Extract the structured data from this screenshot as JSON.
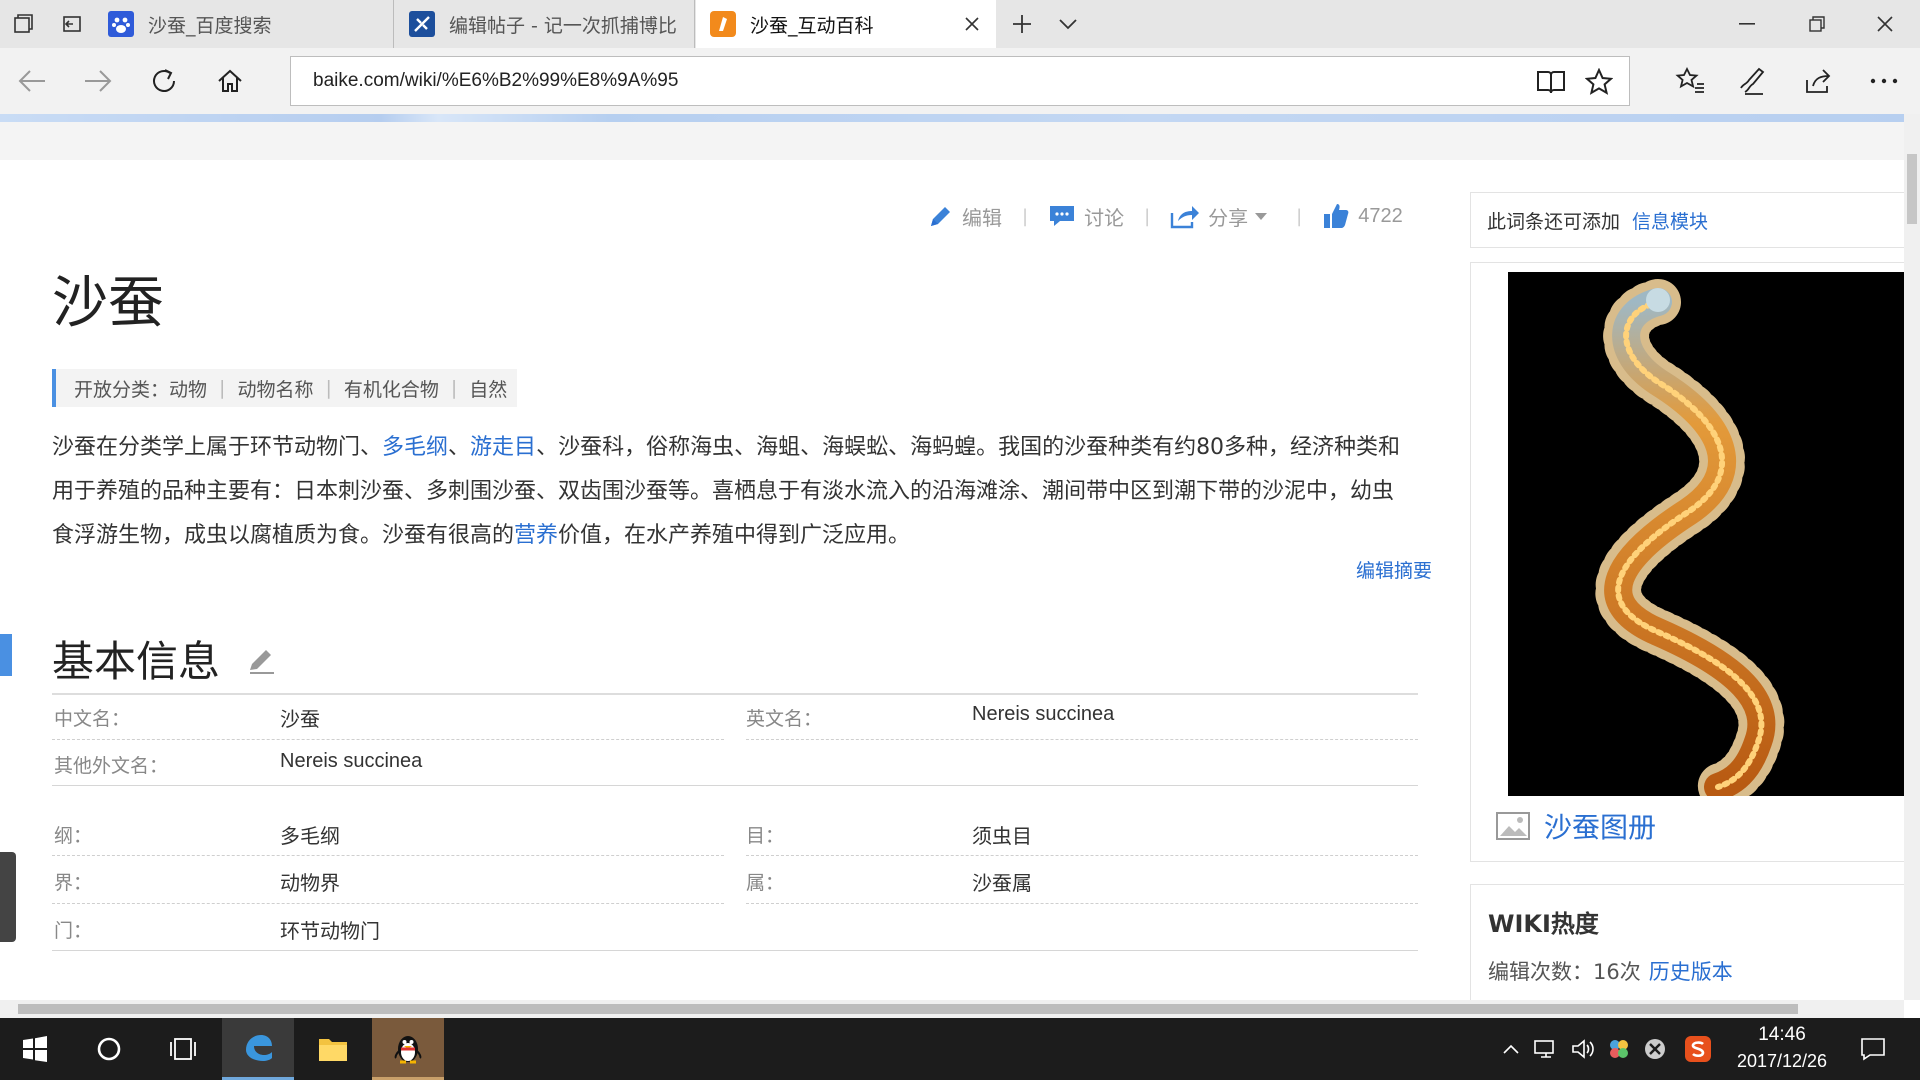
{
  "tabs": [
    {
      "label": "沙蚕_百度搜索",
      "state": "inactive",
      "favicon": "baidu-paw-icon"
    },
    {
      "label": "编辑帖子 - 记一次抓捕博比",
      "state": "inactive",
      "favicon": "csdn-edit-icon"
    },
    {
      "label": "沙蚕_互动百科",
      "state": "active",
      "favicon": "hudong-baike-icon"
    }
  ],
  "address": {
    "url": "baike.com/wiki/%E6%B2%99%E8%9A%95"
  },
  "article": {
    "actions": {
      "edit": "编辑",
      "discuss": "讨论",
      "share": "分享",
      "like_count": "4722"
    },
    "title": "沙蚕",
    "categories": {
      "prefix": "开放分类：",
      "items": [
        "动物",
        "动物名称",
        "有机化合物",
        "自然"
      ],
      "separator": "|"
    },
    "summary": {
      "p1": "沙蚕在分类学上属于环节动物门、",
      "l1": "多毛纲",
      "p2": "、",
      "l2": "游走目",
      "p3": "、沙蚕科，俗称海虫、海蛆、海蜈蚣、海蚂蝗。我国的沙蚕种类有约80多种，经济种类和用于养殖的品种主要有：日本刺沙蚕、多刺围沙蚕、双齿围沙蚕等。喜栖息于有淡水流入的沿海滩涂、潮间带中区到潮下带的沙泥中，幼虫食浮游生物，成虫以腐植质为食。沙蚕有很高的",
      "l3": "营养",
      "p4": "价值，在水产养殖中得到广泛应用。"
    },
    "edit_summary": "编辑摘要",
    "section_title": "基本信息",
    "infobox": {
      "cn_name_label": "中文名：",
      "cn_name": "沙蚕",
      "en_name_label": "英文名：",
      "en_name": "Nereis succinea",
      "other_name_label": "其他外文名：",
      "other_name": "Nereis succinea",
      "class_label": "纲：",
      "class_value": "多毛纲",
      "order_label": "目：",
      "order_value": "须虫目",
      "kingdom_label": "界：",
      "kingdom_value": "动物界",
      "genus_label": "属：",
      "genus_value": "沙蚕属",
      "phylum_label": "门：",
      "phylum_value": "环节动物门"
    }
  },
  "sidebar": {
    "add_text": "此词条还可添加",
    "add_link": "信息模块",
    "album_label": "沙蚕图册",
    "wiki_heading": "WIKI热度",
    "edit_count_text": "编辑次数：16次",
    "history_link": "历史版本"
  },
  "taskbar": {
    "time": "14:46",
    "date": "2017/12/26"
  },
  "colors": {
    "link": "#2a6fd1",
    "accent": "#4a90e2",
    "taskbar": "#1c1c1c"
  }
}
